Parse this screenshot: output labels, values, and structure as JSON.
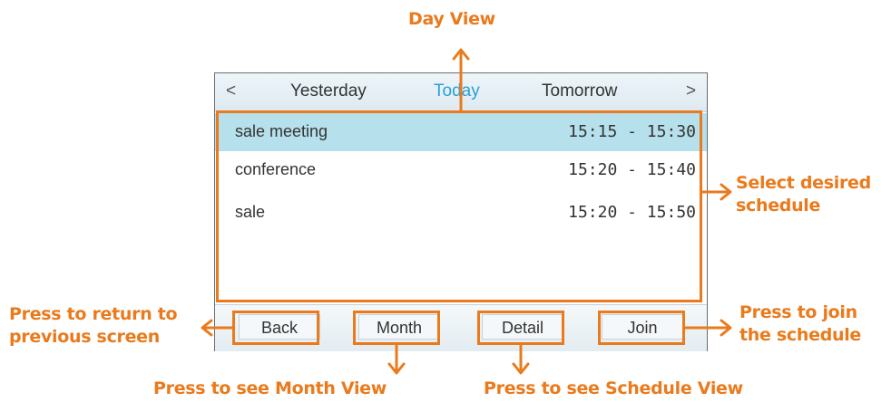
{
  "callouts": {
    "day_view": "Day View",
    "select_schedule": [
      "Select desired",
      "schedule"
    ],
    "return": [
      "Press to return to",
      "previous screen"
    ],
    "join": [
      "Press to join",
      "the schedule"
    ],
    "month_view": "Press to see Month View",
    "schedule_view": "Press to see Schedule View"
  },
  "topbar": {
    "prev": "<",
    "yesterday": "Yesterday",
    "today": "Today",
    "tomorrow": "Tomorrow",
    "next": ">"
  },
  "schedules": [
    {
      "name": "sale meeting",
      "time": "15:15 - 15:30",
      "selected": true
    },
    {
      "name": "conference",
      "time": "15:20 - 15:40",
      "selected": false
    },
    {
      "name": "sale",
      "time": "15:20 - 15:50",
      "selected": false
    }
  ],
  "softkeys": [
    "Back",
    "Month",
    "Detail",
    "Join"
  ],
  "colors": {
    "annotation": "#ea7a1c",
    "today": "#2a9fd6",
    "selected_row": "#b5e0ec"
  }
}
